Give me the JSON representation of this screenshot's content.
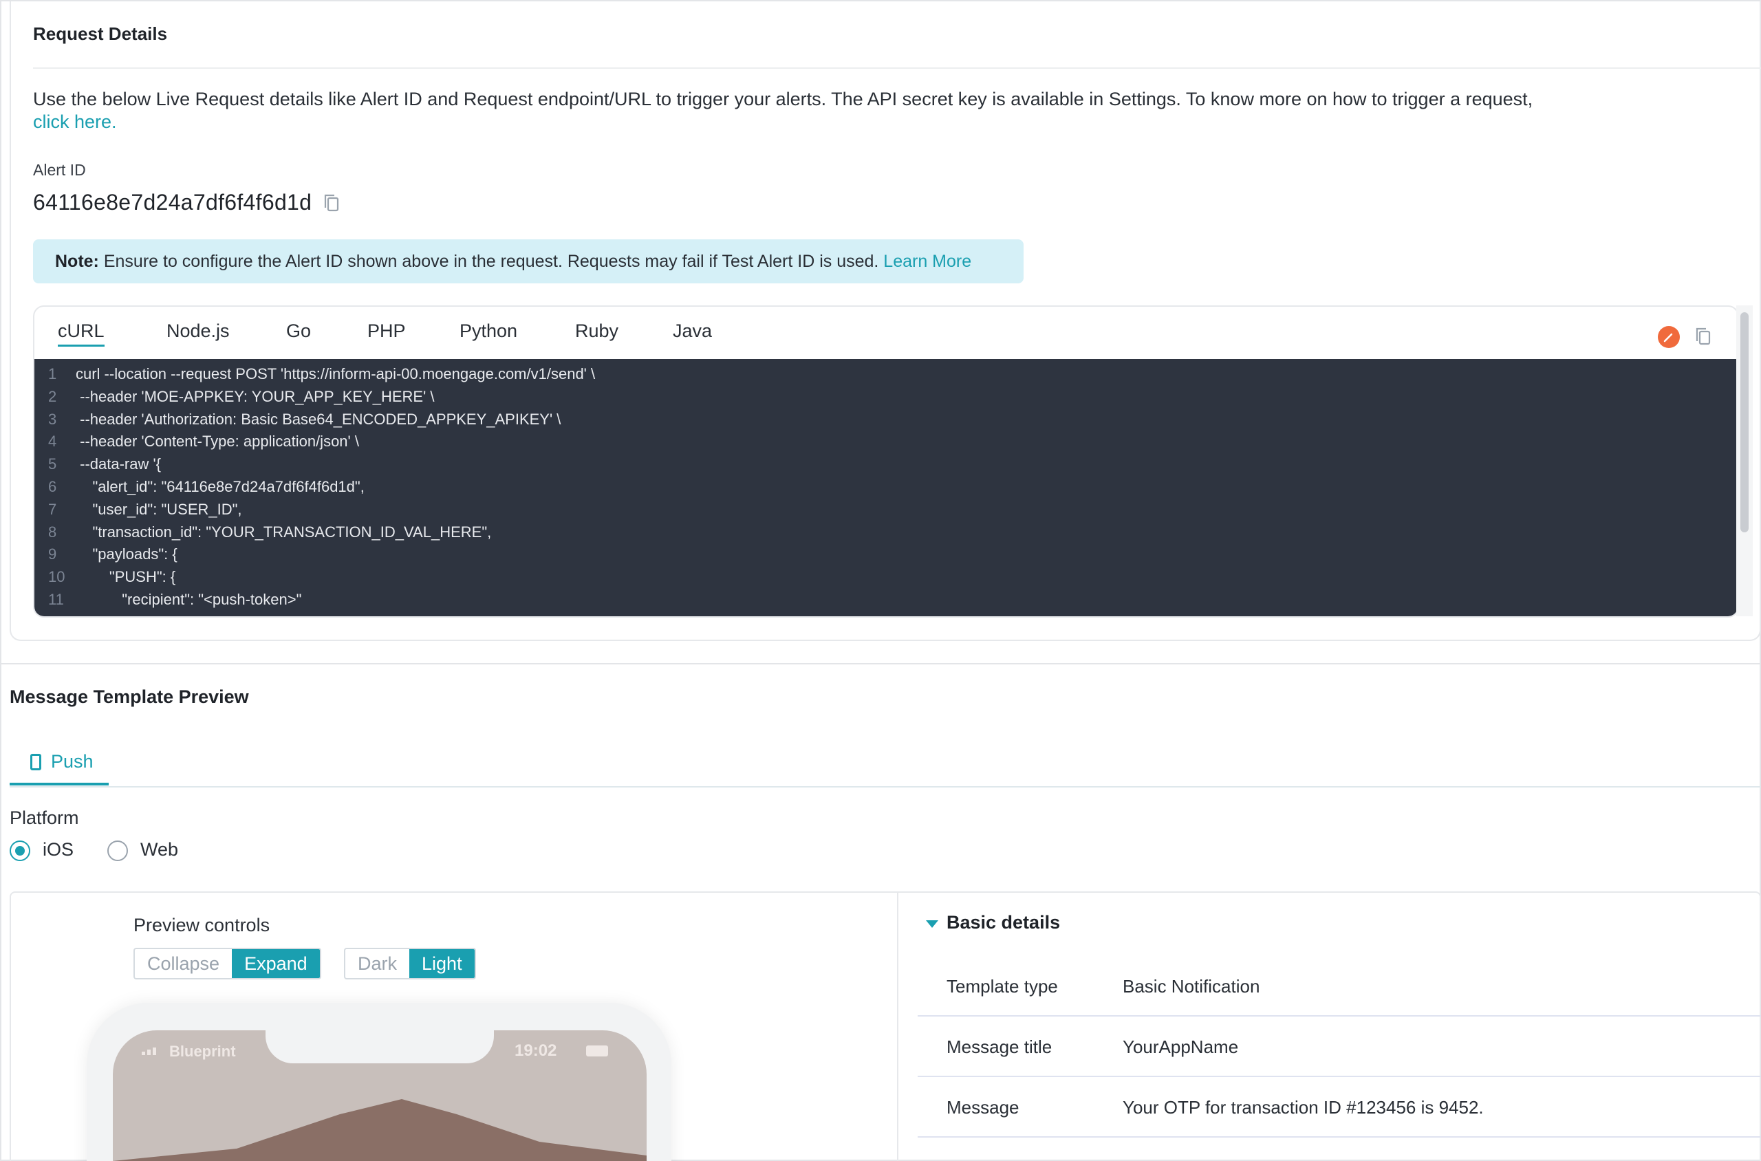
{
  "request": {
    "title": "Request Details",
    "description": "Use the below Live Request details like Alert ID and Request endpoint/URL to trigger your alerts. The API secret key is available in Settings. To know more on how to trigger a request,",
    "link": "click here.",
    "alert_id_label": "Alert ID",
    "alert_id": "64116e8e7d24a7df6f4f6d1d",
    "note_bold": "Note:",
    "note_text": " Ensure to configure the Alert ID shown above in the request. Requests may fail if Test Alert ID is used. ",
    "note_link": "Learn More"
  },
  "code": {
    "tabs": [
      "cURL",
      "Node.js",
      "Go",
      "PHP",
      "Python",
      "Ruby",
      "Java"
    ],
    "active_tab": "cURL",
    "lines": [
      {
        "n": "1",
        "text": "curl --location --request POST 'https://inform-api-00.moengage.com/v1/send' \\"
      },
      {
        "n": "2",
        "text": " --header 'MOE-APPKEY: YOUR_APP_KEY_HERE' \\"
      },
      {
        "n": "3",
        "text": " --header 'Authorization: Basic Base64_ENCODED_APPKEY_APIKEY' \\"
      },
      {
        "n": "4",
        "text": " --header 'Content-Type: application/json' \\"
      },
      {
        "n": "5",
        "text": " --data-raw '{"
      },
      {
        "n": "6",
        "text": "    \"alert_id\": \"64116e8e7d24a7df6f4f6d1d\","
      },
      {
        "n": "7",
        "text": "    \"user_id\": \"USER_ID\","
      },
      {
        "n": "8",
        "text": "    \"transaction_id\": \"YOUR_TRANSACTION_ID_VAL_HERE\","
      },
      {
        "n": "9",
        "text": "    \"payloads\": {"
      },
      {
        "n": "10",
        "text": "        \"PUSH\": {"
      },
      {
        "n": "11",
        "text": "           \"recipient\": \"<push-token>\""
      }
    ],
    "colors": {
      "background": "#2e3440",
      "accent": "#1a9fb0",
      "edit": "#f06a3c"
    }
  },
  "preview": {
    "title": "Message Template Preview",
    "channel_tab": "Push",
    "platform_label": "Platform",
    "platforms": [
      {
        "label": "iOS",
        "selected": true
      },
      {
        "label": "Web",
        "selected": false
      }
    ],
    "controls_label": "Preview controls",
    "size_toggle": {
      "options": [
        "Collapse",
        "Expand"
      ],
      "selected": "Expand"
    },
    "theme_toggle": {
      "options": [
        "Dark",
        "Light"
      ],
      "selected": "Light"
    },
    "phone": {
      "carrier": "Blueprint",
      "time": "19:02"
    }
  },
  "details": {
    "title": "Basic details",
    "rows": [
      {
        "key": "Template type",
        "value": "Basic Notification"
      },
      {
        "key": "Message title",
        "value": "YourAppName"
      },
      {
        "key": "Message",
        "value": "Your OTP for transaction ID #123456 is 9452."
      }
    ]
  }
}
